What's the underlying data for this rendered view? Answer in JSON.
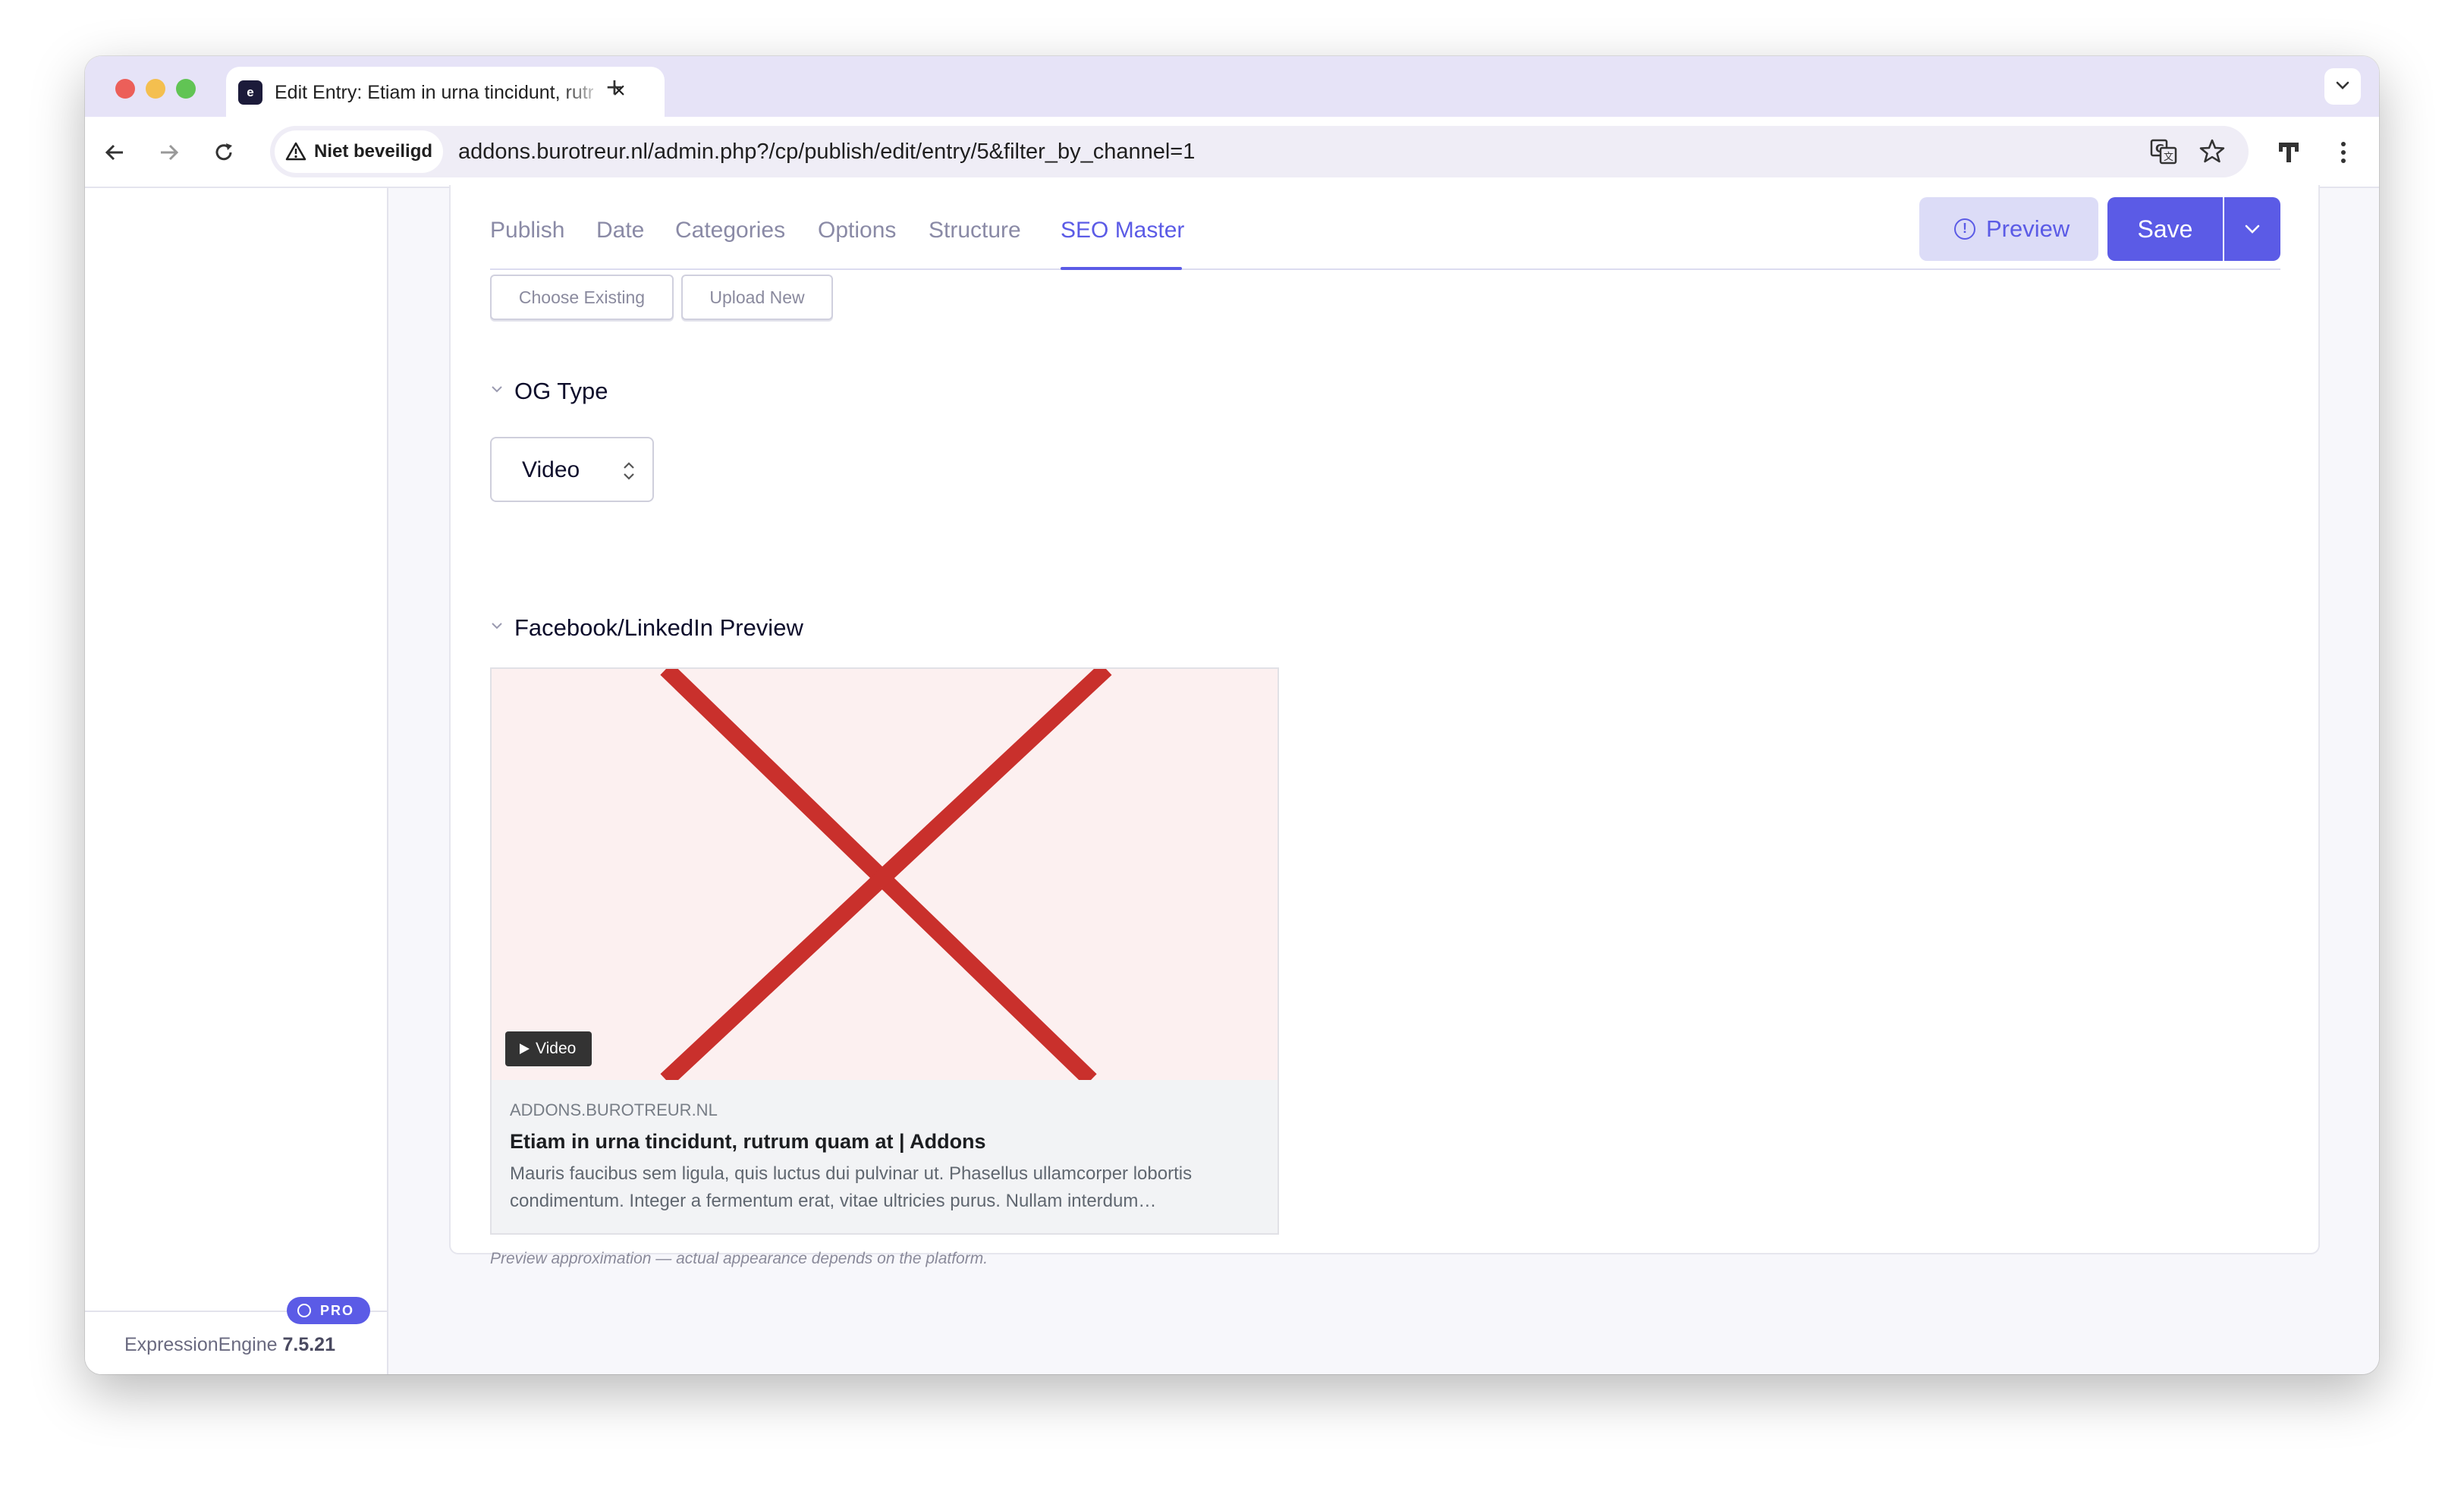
{
  "browser": {
    "tab_title": "Edit Entry: Etiam in urna tincidunt, rutrum quam at",
    "favicon_text": "e",
    "security_label": "Niet beveiligd",
    "url": "addons.burotreur.nl/admin.php?/cp/publish/edit/entry/5&filter_by_channel=1",
    "icons": [
      "back-arrow-icon",
      "forward-arrow-icon",
      "reload-icon",
      "warning-triangle-icon",
      "translate-icon",
      "star-icon",
      "extension-icon",
      "kebab-menu-icon"
    ]
  },
  "sidebar": {
    "pro_badge": "PRO",
    "product_name": "ExpressionEngine",
    "version": "7.5.21"
  },
  "tabs": [
    {
      "label": "Publish",
      "active": false
    },
    {
      "label": "Date",
      "active": false
    },
    {
      "label": "Categories",
      "active": false
    },
    {
      "label": "Options",
      "active": false
    },
    {
      "label": "Structure",
      "active": false
    },
    {
      "label": "SEO Master",
      "active": true
    }
  ],
  "actions": {
    "preview_label": "Preview",
    "save_label": "Save"
  },
  "image_buttons": {
    "choose_existing": "Choose Existing",
    "upload_new": "Upload New"
  },
  "og_type": {
    "heading": "OG Type",
    "value": "Video"
  },
  "fb_preview": {
    "heading": "Facebook/LinkedIn Preview",
    "video_badge": "Video",
    "domain": "ADDONS.BUROTREUR.NL",
    "title": "Etiam in urna tincidunt, rutrum quam at | Addons",
    "description": "Mauris faucibus sem ligula, quis luctus dui pulvinar ut. Phasellus ullamcorper lobortis condimentum. Integer a fermentum erat, vitae ultricies purus. Nullam interdum…",
    "note": "Preview approximation — actual appearance depends on the platform."
  },
  "colors": {
    "accent": "#5b5be6",
    "tabstrip": "#e6e3f7",
    "broken_image_cross": "#c9302c"
  }
}
